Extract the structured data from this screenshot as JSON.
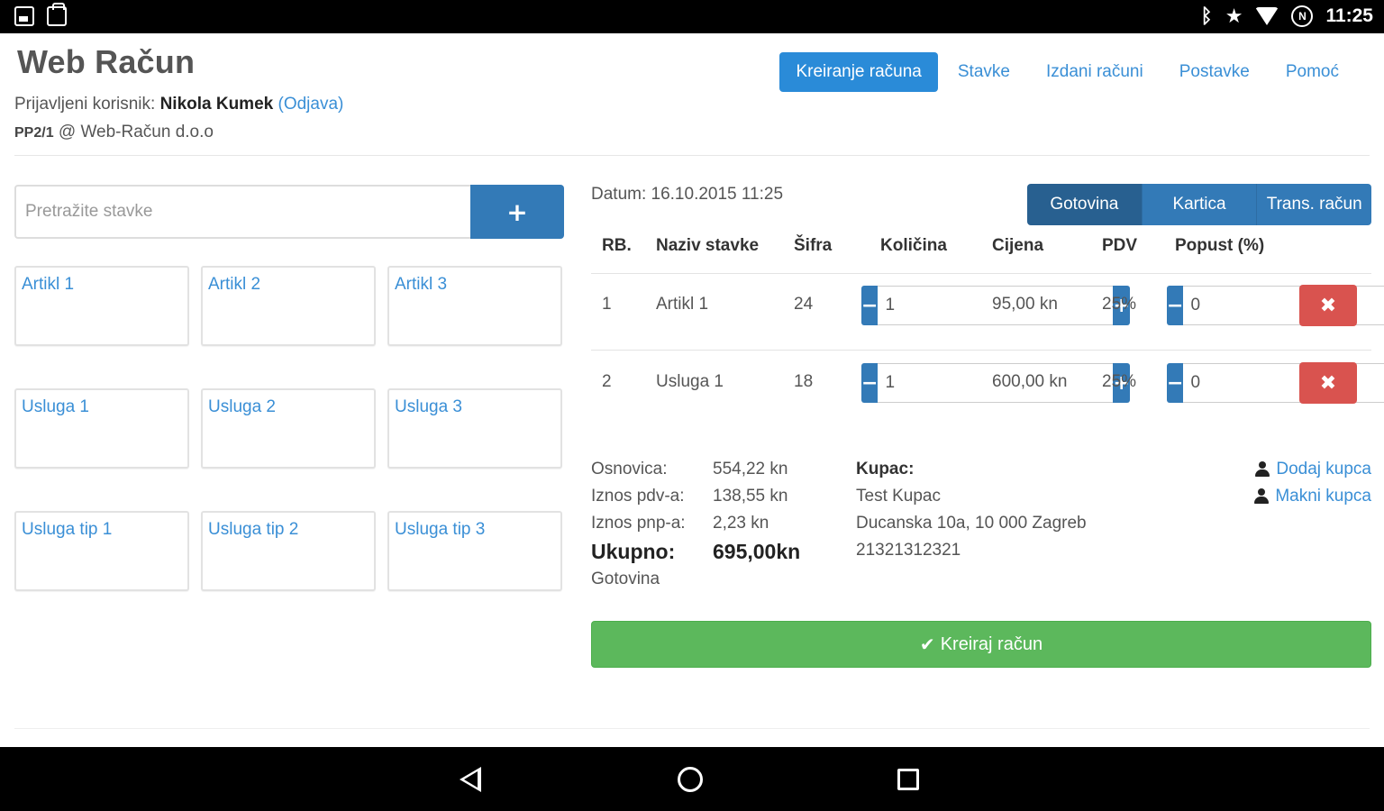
{
  "status_bar": {
    "time": "11:25",
    "nfc": "N"
  },
  "header": {
    "title": "Web Račun",
    "user_prefix": "Prijavljeni korisnik:",
    "user_name": "Nikola Kumek",
    "logout": "(Odjava)",
    "location_code": "PP2/1",
    "location_rest": "@ Web-Račun d.o.o"
  },
  "nav": {
    "items": [
      "Kreiranje računa",
      "Stavke",
      "Izdani računi",
      "Postavke",
      "Pomoć"
    ]
  },
  "search": {
    "placeholder": "Pretražite stavke",
    "add_label": "+"
  },
  "tiles": [
    "Artikl 1",
    "Artikl 2",
    "Artikl 3",
    "Usluga 1",
    "Usluga 2",
    "Usluga 3",
    "Usluga tip 1",
    "Usluga tip 2",
    "Usluga tip 3"
  ],
  "invoice": {
    "datum": "Datum: 16.10.2015 11:25",
    "payment_options": [
      "Gotovina",
      "Kartica",
      "Trans. račun"
    ],
    "headers": [
      "RB.",
      "Naziv stavke",
      "Šifra",
      "Količina",
      "Cijena",
      "PDV",
      "Popust (%)"
    ],
    "rows": [
      {
        "rb": "1",
        "naziv": "Artikl 1",
        "sifra": "24",
        "kolicina": "1",
        "cijena": "95,00 kn",
        "pdv": "25%",
        "popust": "0"
      },
      {
        "rb": "2",
        "naziv": "Usluga 1",
        "sifra": "18",
        "kolicina": "1",
        "cijena": "600,00 kn",
        "pdv": "25%",
        "popust": "0"
      }
    ],
    "stepper_minus": "−",
    "stepper_plus": "+",
    "delete_label": "✖"
  },
  "totals": {
    "osnovica_label": "Osnovica:",
    "osnovica": "554,22 kn",
    "pdv_label": "Iznos pdv-a:",
    "pdv": "138,55 kn",
    "pnp_label": "Iznos pnp-a:",
    "pnp": "2,23 kn",
    "ukupno_label": "Ukupno:",
    "ukupno": "695,00kn",
    "payment": "Gotovina"
  },
  "customer": {
    "heading": "Kupac:",
    "name": "Test Kupac",
    "address": "Ducanska 10a, 10 000 Zagreb",
    "oib": "21321312321",
    "add_link": "Dodaj kupca",
    "remove_link": "Makni kupca"
  },
  "actions": {
    "create": "Kreiraj račun"
  },
  "colors": {
    "primary": "#337ab7",
    "link": "#3a8fd6",
    "success": "#5cb85c",
    "danger": "#d9534f"
  }
}
